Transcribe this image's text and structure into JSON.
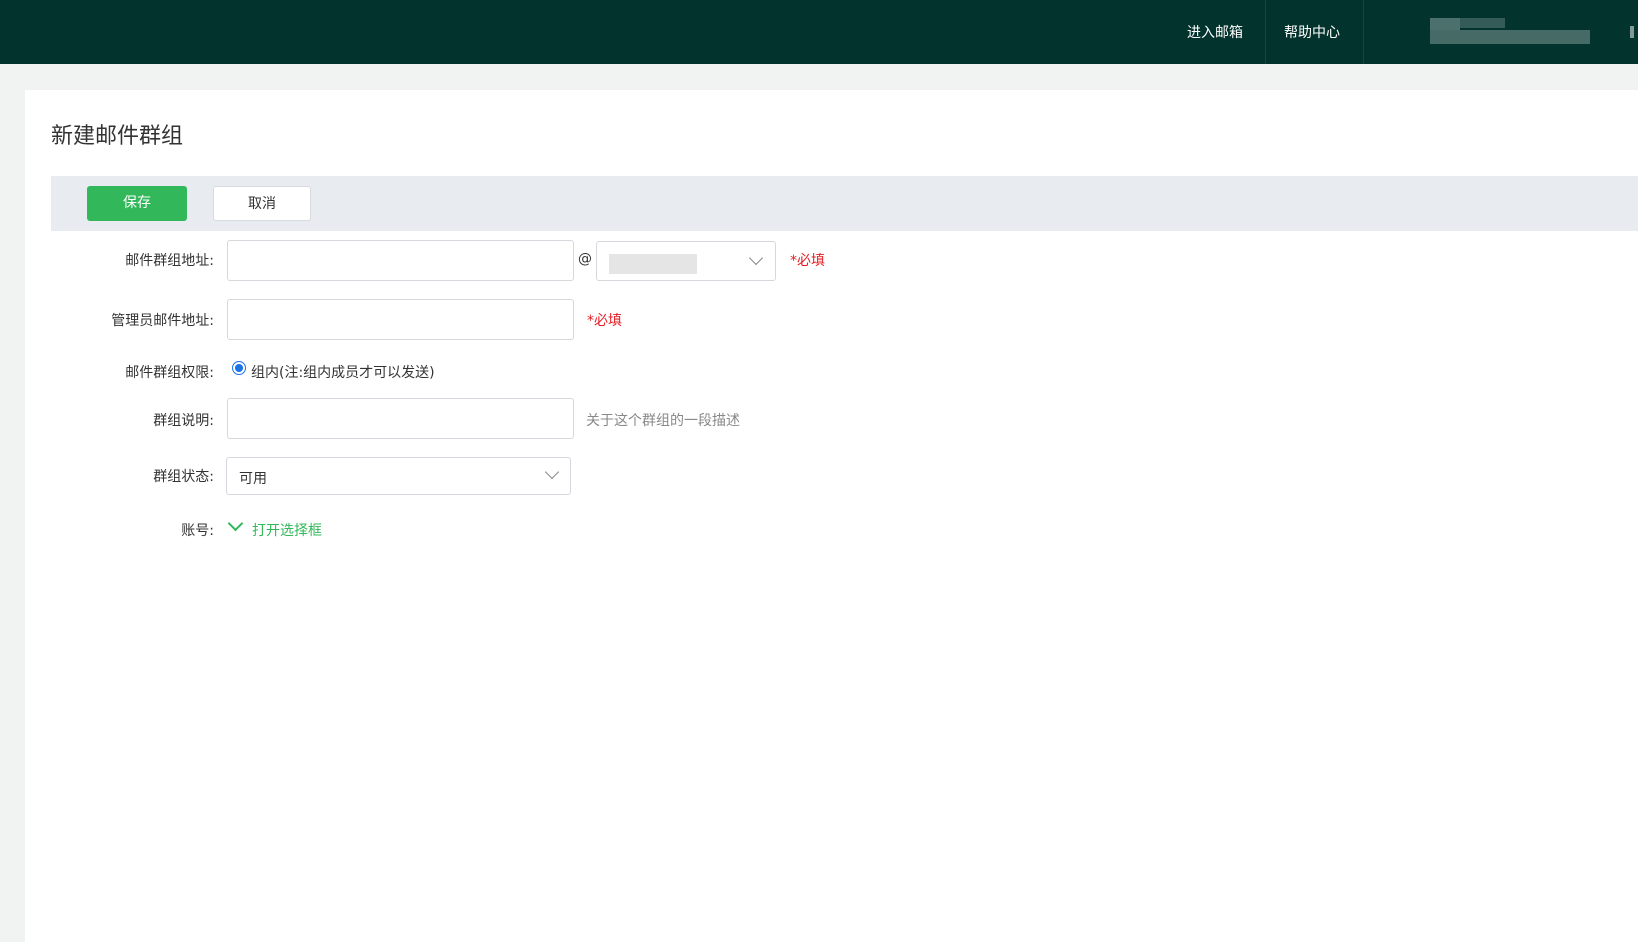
{
  "header": {
    "links": [
      "进入邮箱",
      "帮助中心"
    ]
  },
  "page": {
    "title": "新建邮件群组"
  },
  "toolbar": {
    "save_label": "保存",
    "cancel_label": "取消"
  },
  "form": {
    "group_address": {
      "label": "邮件群组地址:",
      "value": "",
      "at": "@",
      "required": "*必填"
    },
    "admin_address": {
      "label": "管理员邮件地址:",
      "value": "",
      "required": "*必填"
    },
    "permission": {
      "label": "邮件群组权限:",
      "option": "组内(注:组内成员才可以发送)",
      "checked": true
    },
    "description": {
      "label": "群组说明:",
      "value": "",
      "hint": "关于这个群组的一段描述"
    },
    "status": {
      "label": "群组状态:",
      "value": "可用"
    },
    "account": {
      "label": "账号:",
      "link": "打开选择框"
    }
  },
  "colors": {
    "header_bg": "#02332d",
    "primary": "#32b75a",
    "required": "#e51c23",
    "radio": "#1a73e8"
  }
}
